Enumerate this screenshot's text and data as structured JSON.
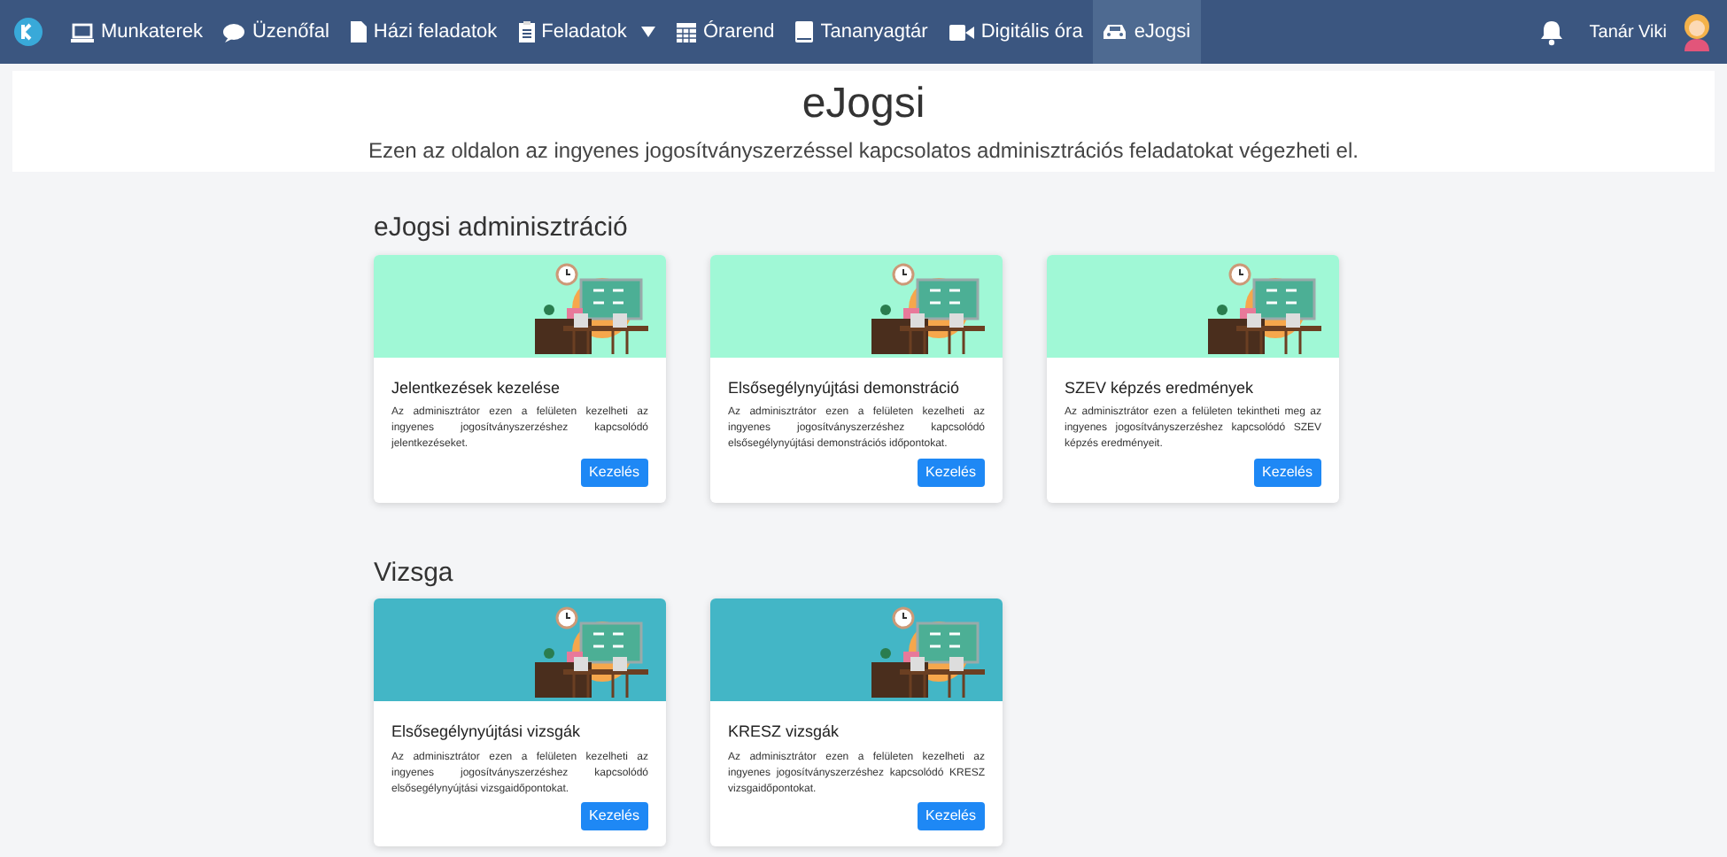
{
  "navbar": {
    "items": [
      {
        "label": "Munkaterek",
        "selected": false,
        "dropdown": false
      },
      {
        "label": "Üzenőfal",
        "selected": false,
        "dropdown": false
      },
      {
        "label": "Házi feladatok",
        "selected": false,
        "dropdown": false
      },
      {
        "label": "Feladatok",
        "selected": false,
        "dropdown": true
      },
      {
        "label": "Órarend",
        "selected": false,
        "dropdown": false
      },
      {
        "label": "Tananyagtár",
        "selected": false,
        "dropdown": false
      },
      {
        "label": "Digitális óra",
        "selected": false,
        "dropdown": false
      },
      {
        "label": "eJogsi",
        "selected": true,
        "dropdown": false
      }
    ],
    "user": "Tanár Viki"
  },
  "header": {
    "title": "eJogsi",
    "subtitle": "Ezen az oldalon az ingyenes jogosítványszerzéssel kapcsolatos adminisztrációs feladatokat végezheti el."
  },
  "sections": [
    {
      "title": "eJogsi adminisztráció",
      "color": "#a0f8d6",
      "cards": [
        {
          "title": "Jelentkezések kezelése",
          "text": "Az adminisztrátor ezen a felületen kezelheti az ingyenes jogosítványszerzéshez kapcsolódó jelentkezéseket.",
          "button": "Kezelés"
        },
        {
          "title": "Elsősegélynyújtási demonstráció",
          "text": "Az adminisztrátor ezen a felületen kezelheti az ingyenes jogosítványszerzéshez kapcsolódó elsősegélynyújtási demonstrációs időpontokat.",
          "button": "Kezelés"
        },
        {
          "title": "SZEV képzés eredmények",
          "text": "Az adminisztrátor ezen a felületen tekintheti meg az ingyenes jogosítványszerzéshez kapcsolódó SZEV képzés eredményeit.",
          "button": "Kezelés"
        }
      ]
    },
    {
      "title": "Vizsga",
      "color": "#43b6c6",
      "cards": [
        {
          "title": "Elsősegélynyújtási vizsgák",
          "text": "Az adminisztrátor ezen a felületen kezelheti az ingyenes jogosítványszerzéshez kapcsolódó elsősegélynyújtási vizsgaidőpontokat.",
          "button": "Kezelés"
        },
        {
          "title": "KRESZ vizsgák",
          "text": "Az adminisztrátor ezen a felületen kezelheti az ingyenes jogosítványszerzéshez kapcsolódó KRESZ vizsgaidőpontokat.",
          "button": "Kezelés"
        }
      ]
    }
  ]
}
